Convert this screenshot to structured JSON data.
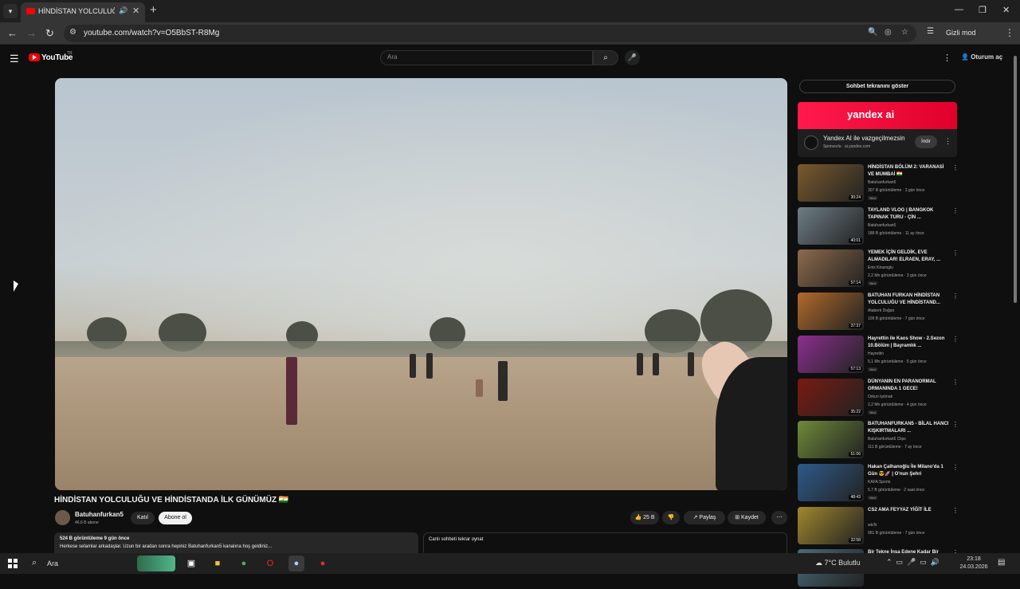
{
  "browser": {
    "tab_title": "HİNDİSTAN YOLCULUĞU VE",
    "audio_icon": "speaker-icon",
    "url": "youtube.com/watch?v=O5BbST-R8Mg",
    "incognito_label": "Gizli mod"
  },
  "yt": {
    "logo_text": "YouTube",
    "country": "TR",
    "search_placeholder": "Ara",
    "signin_label": "Oturum aç"
  },
  "video": {
    "title": "HİNDİSTAN YOLCULUĞU VE HİNDİSTANDA İLK GÜNÜMÜZ 🇮🇳",
    "channel": "Batuhanfurkan5",
    "subscribers": "46,6 B abone",
    "join_label": "Katıl",
    "subscribe_label": "Abone ol",
    "likes": "25 B",
    "share_label": "Paylaş",
    "save_label": "Kaydet",
    "desc_stats": "524 B görüntüleme  9 gün önce",
    "desc_text": "Herkese selamlar arkadaşlar. Uzun bir aradan sonra hepiniz Batuhanfurkan5 kanalına hoş geldiniz...",
    "chat_replay_label": "Canlı sohbeti tekrar oynat"
  },
  "sidebar": {
    "chat_toggle": "Sohbet tekranını göster",
    "ad": {
      "brand": "yandex ai",
      "title": "Yandex AI ile vazgeçilmezsin",
      "sponsor": "Sponsorlu · ai.yandex.com",
      "cta": "İndir"
    },
    "recs": [
      {
        "title": "HİNDİSTAN BÖLÜM 2: VARANASİ VE MUMBAİ 🇮🇳",
        "channel": "Batuhanfurkan5",
        "meta": "307 B görüntüleme · 3 gün önce",
        "badge": "Yeni",
        "duration": "30:24",
        "color": "#7a5a2e"
      },
      {
        "title": "TAYLAND VLOG | BANGKOK TAPINAK TURU - ÇİN ...",
        "channel": "Batuhanfurkan5",
        "meta": "188 B görüntüleme · 11 ay önce",
        "badge": "",
        "duration": "40:01",
        "color": "#6f7d86"
      },
      {
        "title": "YEMEK İÇİN GELDİK, EVE ALMADILAR! ELRAEN, ERAY, ...",
        "channel": "Enis Kirazoglu",
        "meta": "2,2 Mn görüntüleme · 3 gün önce",
        "badge": "Yeni",
        "duration": "57:14",
        "color": "#8d6a4c"
      },
      {
        "title": "BATUHAN FURKAN HİNDİSTAN YOLCULUĞU VE HİNDİSTAND...",
        "channel": "Ataberk Doğan",
        "meta": "109 B görüntüleme · 7 gün önce",
        "badge": "",
        "duration": "37:37",
        "color": "#b06a2b"
      },
      {
        "title": "Hayrettin ile Kaos Show - 2.Sezon 10.Bölüm | Bayramlık ...",
        "channel": "Hayrettin",
        "meta": "5,1 Mn görüntüleme · 5 gün önce",
        "badge": "Yeni",
        "duration": "57:13",
        "color": "#8b2f8f"
      },
      {
        "title": "DÜNYANIN EN PARANORMAL ORMANINDA 1 GECE!",
        "channel": "Orkun Işıtmak",
        "meta": "2,2 Mn görüntüleme · 4 gün önce",
        "badge": "Yeni",
        "duration": "35:22",
        "color": "#7a1a12"
      },
      {
        "title": "BATUHANFURKAN5 - BİLAL HANCI KIŞKIRTMALARI ...",
        "channel": "Batuhanfurkan5 Clips",
        "meta": "111 B görüntüleme · 7 ay önce",
        "badge": "",
        "duration": "51:06",
        "color": "#6f8a3a"
      },
      {
        "title": "Hakan Çalhanoğlu İle Milano'da 1 Gün 😎🚀 | O'nun Şehri",
        "channel": "KAFA Sports",
        "meta": "5,7 B görüntüleme · 2 saat önce",
        "badge": "Yeni",
        "duration": "48:43",
        "color": "#2e5a8a"
      },
      {
        "title": "CS2 AMA FEYYAZ YİĞİT İLE",
        "channel": "wtcN",
        "meta": "961 B görüntüleme · 7 gün önce",
        "badge": "",
        "duration": "32:58",
        "color": "#a0872e"
      },
      {
        "title": "Bir Tekne İnşa Edene Kadar Bir",
        "channel": "",
        "meta": "",
        "badge": "",
        "duration": "",
        "color": "#4a6a7a"
      }
    ]
  },
  "taskbar": {
    "search_label": "Ara",
    "weather": "7°C  Bulutlu",
    "time": "23:18",
    "date": "24.03.2026"
  }
}
